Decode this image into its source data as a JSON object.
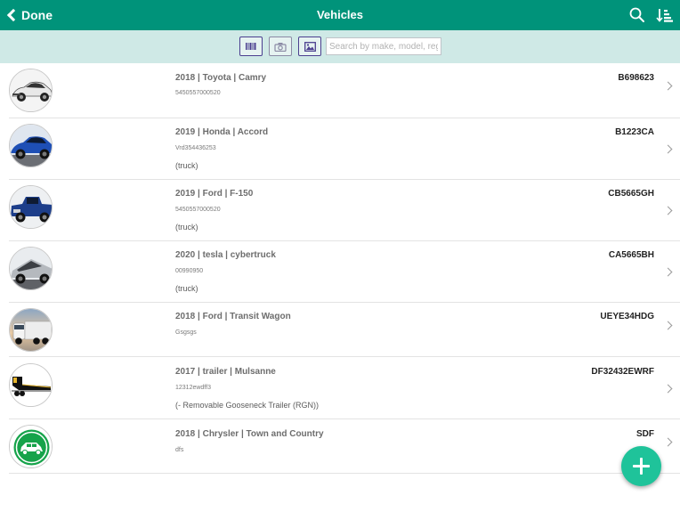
{
  "navbar": {
    "back_label": "Done",
    "title": "Vehicles",
    "search_icon": "search-icon",
    "sort_icon": "sort-icon"
  },
  "toolbar": {
    "icons": [
      "barcode-icon",
      "camera-icon",
      "image-icon"
    ],
    "search_placeholder": "Search by make, model, reg.",
    "search_value": ""
  },
  "vehicles": [
    {
      "title": "2018 | Toyota | Camry",
      "vin": "5450557000520",
      "type": "",
      "reg": "B698623",
      "image": "white-sedan"
    },
    {
      "title": "2019 | Honda | Accord",
      "vin": "Vrd354436253",
      "type": "(truck)",
      "reg": "B1223CA",
      "image": "blue-sedan"
    },
    {
      "title": "2019 | Ford | F-150",
      "vin": "5450557000520",
      "type": "(truck)",
      "reg": "CB5665GH",
      "image": "blue-pickup"
    },
    {
      "title": "2020 | tesla | cybertruck",
      "vin": "00990950",
      "type": "(truck)",
      "reg": "CA5665BH",
      "image": "silver-cybertruck"
    },
    {
      "title": "2018 | Ford | Transit Wagon",
      "vin": "Gsgsgs",
      "type": "",
      "reg": "UEYE34HDG",
      "image": "white-semi-truck"
    },
    {
      "title": "2017 | trailer | Mulsanne",
      "vin": "12312ewdff3",
      "type": "(- Removable Gooseneck Trailer (RGN))",
      "reg": "DF32432EWRF",
      "image": "gooseneck-trailer"
    },
    {
      "title": "2018 | Chrysler | Town and Country",
      "vin": "dfs",
      "type": "",
      "reg": "SDF",
      "image": "green-car-badge"
    }
  ],
  "fab": {
    "icon": "plus-icon"
  },
  "colors": {
    "primary": "#00937a",
    "toolbar_bg": "#cfe9e6",
    "fab": "#1fc39a",
    "tool_border": "#4b3f8f"
  }
}
